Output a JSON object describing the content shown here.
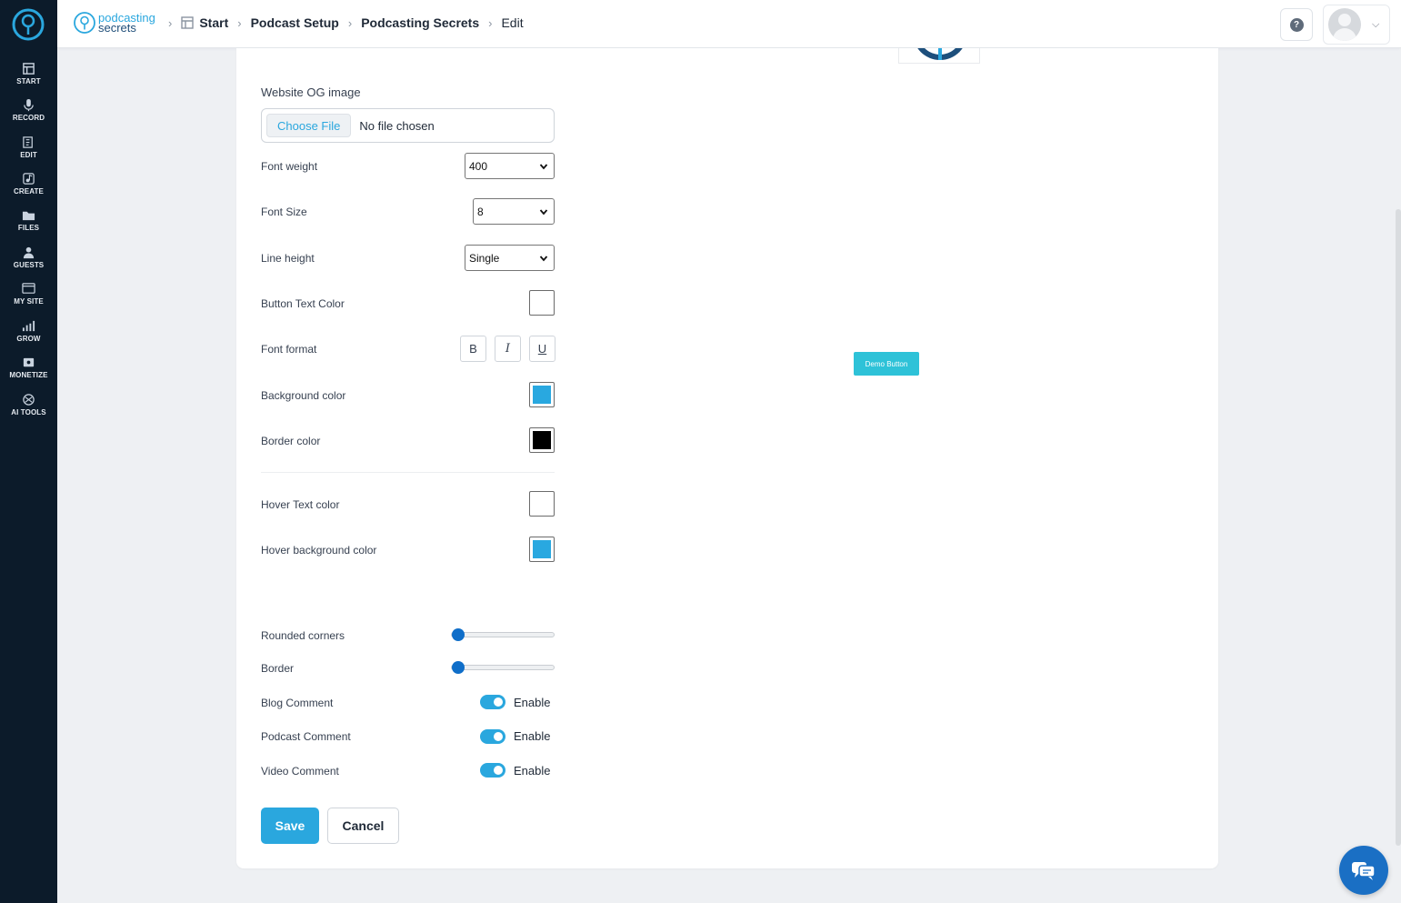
{
  "sidebar": {
    "items": [
      {
        "label": "START",
        "icon": "start-icon"
      },
      {
        "label": "RECORD",
        "icon": "microphone-icon"
      },
      {
        "label": "EDIT",
        "icon": "edit-icon"
      },
      {
        "label": "CREATE",
        "icon": "create-icon"
      },
      {
        "label": "FILES",
        "icon": "files-icon"
      },
      {
        "label": "GUESTS",
        "icon": "guests-icon"
      },
      {
        "label": "MY SITE",
        "icon": "my-site-icon"
      },
      {
        "label": "GROW",
        "icon": "grow-icon"
      },
      {
        "label": "MONETIZE",
        "icon": "monetize-icon"
      },
      {
        "label": "AI TOOLS",
        "icon": "ai-tools-icon"
      }
    ]
  },
  "header": {
    "brand_line1": "podcasting",
    "brand_line2": "secrets",
    "breadcrumbs": [
      "Start",
      "Podcast Setup",
      "Podcasting Secrets",
      "Edit"
    ],
    "help_glyph": "?"
  },
  "form": {
    "og_image_label": "Website OG image",
    "file_button": "Choose File",
    "file_status": "No file chosen",
    "font_weight_label": "Font weight",
    "font_weight_value": "400",
    "font_size_label": "Font Size",
    "font_size_value": "8",
    "line_height_label": "Line height",
    "line_height_value": "Single",
    "button_text_color_label": "Button Text Color",
    "button_text_color": "#ffffff",
    "font_format_label": "Font format",
    "format_bold": "B",
    "format_italic": "I",
    "format_underline": "U",
    "background_color_label": "Background color",
    "background_color": "#29a8e0",
    "border_color_label": "Border color",
    "border_color": "#000000",
    "hover_text_color_label": "Hover Text color",
    "hover_text_color": "#ffffff",
    "hover_background_color_label": "Hover background color",
    "hover_background_color": "#29a8e0",
    "rounded_corners_label": "Rounded corners",
    "rounded_corners_value": 0,
    "border_label": "Border",
    "border_value": 0,
    "blog_comment_label": "Blog Comment",
    "podcast_comment_label": "Podcast Comment",
    "video_comment_label": "Video Comment",
    "enable_text": "Enable",
    "save_label": "Save",
    "cancel_label": "Cancel"
  },
  "preview": {
    "demo_button_label": "Demo Button"
  },
  "colors": {
    "accent": "#2aa7de",
    "sidebar_bg": "#0c1b2a",
    "demo_button": "#2ec2d8"
  }
}
